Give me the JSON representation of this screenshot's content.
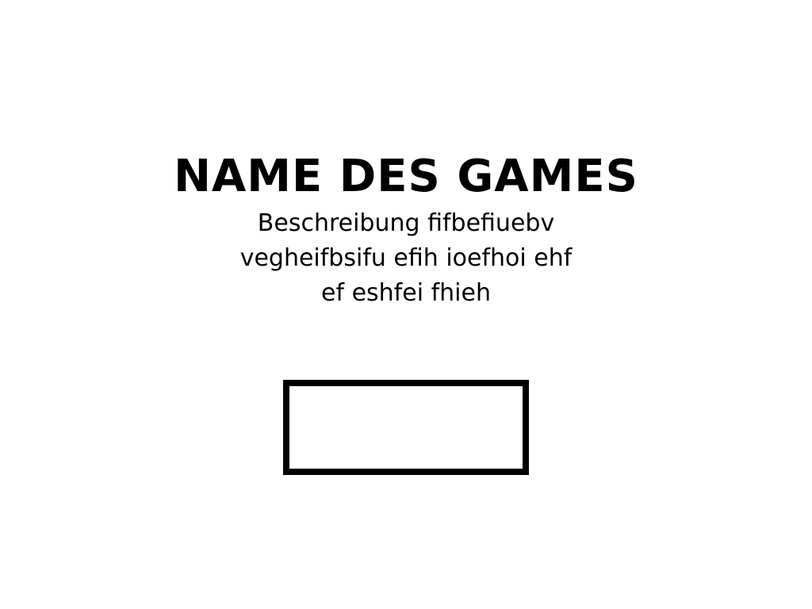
{
  "game": {
    "title": "NAME DES GAMES",
    "description_lines": [
      "Beschreibung fifbefiuebv",
      "vegheifbsifu efih ioefhoi ehf",
      "ef eshfei fhieh"
    ]
  },
  "colors": {
    "background": "#ffffff",
    "foreground": "#000000"
  }
}
